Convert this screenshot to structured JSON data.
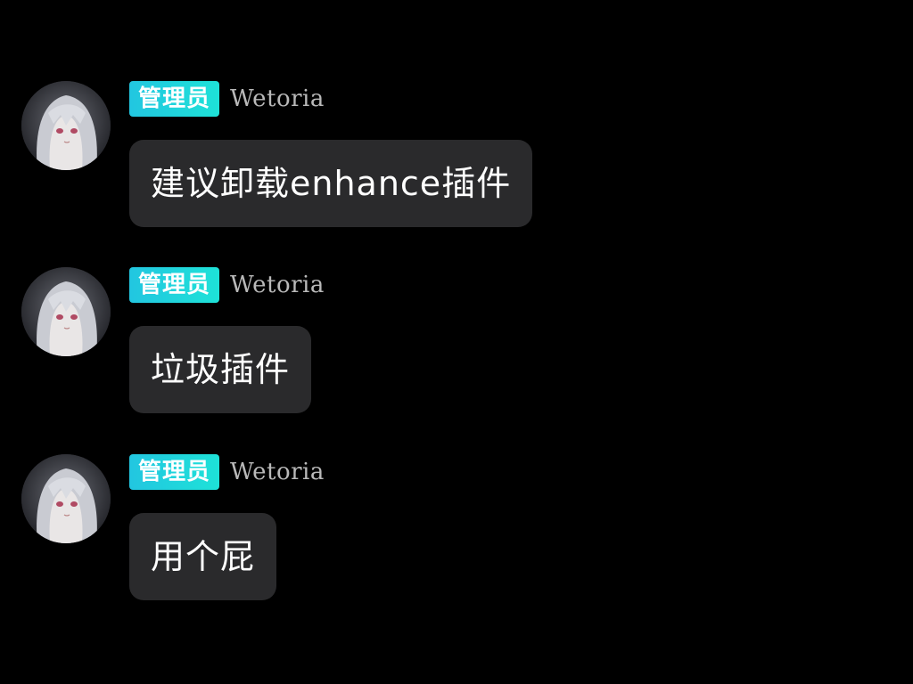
{
  "messages": [
    {
      "role_badge": "管理员",
      "username": "Wetoria",
      "avatar_icon": "anime-avatar-icon",
      "text": "建议卸载enhance插件"
    },
    {
      "role_badge": "管理员",
      "username": "Wetoria",
      "avatar_icon": "anime-avatar-icon",
      "text": "垃圾插件"
    },
    {
      "role_badge": "管理员",
      "username": "Wetoria",
      "avatar_icon": "anime-avatar-icon",
      "text": "用个屁"
    }
  ],
  "colors": {
    "background": "#000000",
    "badge": "#22c6e0",
    "bubble": "#2a2a2c",
    "username": "#b9b9b9",
    "text": "#ffffff"
  }
}
